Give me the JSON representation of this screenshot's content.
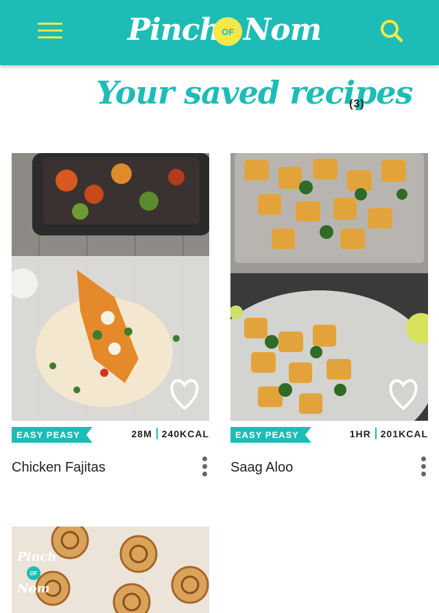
{
  "header": {
    "logo_word_1": "Pinch",
    "logo_of": "OF",
    "logo_word_2": "Nom",
    "menu_icon": "hamburger-menu-icon",
    "search_icon": "search-icon"
  },
  "page": {
    "title": "Your saved recipes",
    "count": "(3)"
  },
  "recipes": [
    {
      "name": "Chicken Fajitas",
      "badge": "EASY PEASY",
      "time": "28M",
      "calories": "240KCAL",
      "image_icon": "chicken-fajitas-photo",
      "saved_icon": "heart-icon"
    },
    {
      "name": "Saag Aloo",
      "badge": "EASY PEASY",
      "time": "1HR",
      "calories": "201KCAL",
      "image_icon": "saag-aloo-photo",
      "saved_icon": "heart-icon"
    },
    {
      "image_icon": "cinnamon-swirls-photo",
      "watermark_word_1": "Pinch",
      "watermark_of": "OF",
      "watermark_word_2": "Nom"
    }
  ],
  "colors": {
    "brand_teal": "#1ebcb6",
    "brand_yellow": "#f7e84a",
    "text_dark": "#222222"
  }
}
